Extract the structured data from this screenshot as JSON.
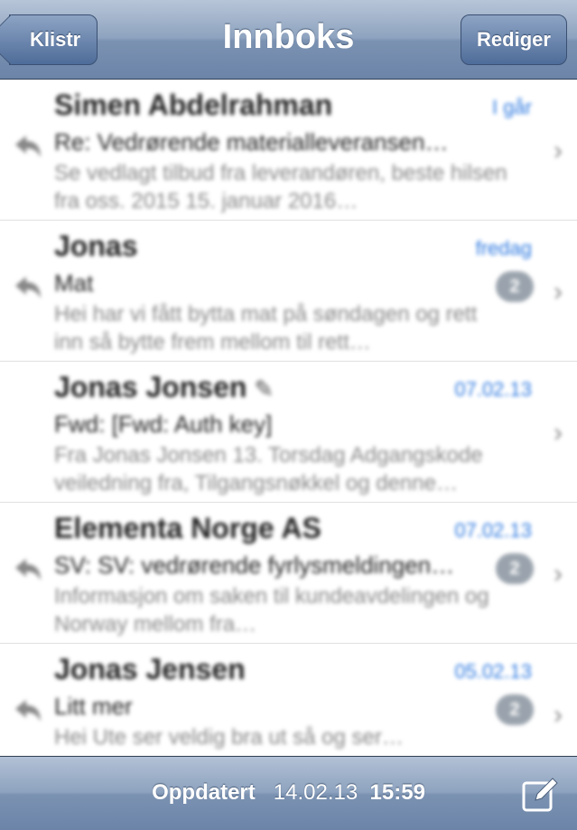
{
  "nav": {
    "back_label": "Klistr",
    "title": "Innboks",
    "edit_label": "Rediger"
  },
  "messages": [
    {
      "sender": "Simen Abdelrahman",
      "date": "I går",
      "subject": "Re: Vedrørende materialleveransen…",
      "preview": "Se vedlagt tilbud fra leverandøren, beste hilsen fra oss. 2015 15. januar 2016…",
      "unread_count": "",
      "attachment": false
    },
    {
      "sender": "Jonas",
      "date": "fredag",
      "subject": "Mat",
      "preview": "Hei har vi fått bytta mat på søndagen og rett inn så bytte frem mellom til rett…",
      "unread_count": "2",
      "attachment": false
    },
    {
      "sender": "Jonas Jonsen",
      "date": "07.02.13",
      "subject": "Fwd: [Fwd: Auth key]",
      "preview": "Fra Jonas Jonsen 13. Torsdag Adgangskode veiledning fra, Tilgangsnøkkel og denne…",
      "unread_count": "",
      "attachment": true
    },
    {
      "sender": "Elementa Norge AS",
      "date": "07.02.13",
      "subject": "SV: SV: vedrørende fyrlysmeldingen…",
      "preview": "Informasjon om saken til kundeavdelingen og Norway mellom fra…",
      "unread_count": "2",
      "attachment": false
    },
    {
      "sender": "Jonas Jensen",
      "date": "05.02.13",
      "subject": "Litt mer",
      "preview": "Hei Ute ser veldig bra ut så og ser…",
      "unread_count": "2",
      "attachment": false
    }
  ],
  "toolbar": {
    "status_label": "Oppdatert",
    "status_date": "14.02.13",
    "status_time": "15:59"
  },
  "icons": {
    "back": "back-arrow",
    "reply": "reply-arrow-icon",
    "chevron": "chevron-right-icon",
    "attachment": "paperclip-icon",
    "compose": "compose-icon"
  },
  "colors": {
    "nav": "#8ea3bf",
    "date": "#2f7ae0",
    "text": "#222222",
    "preview": "#888888"
  }
}
